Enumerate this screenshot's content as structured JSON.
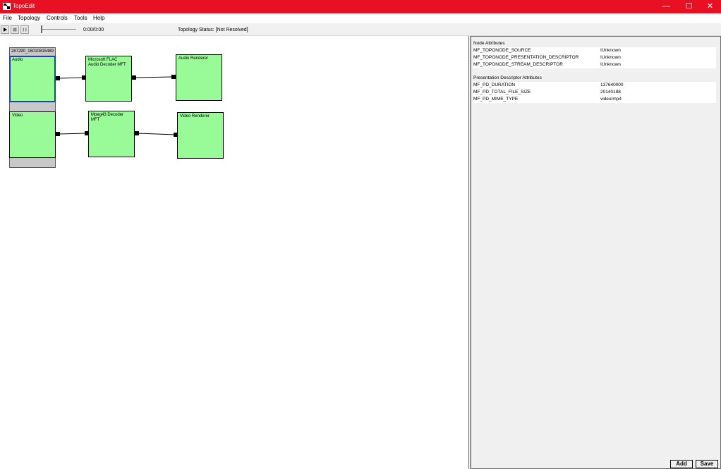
{
  "window": {
    "title": "TopoEdit",
    "minimize_glyph": "—",
    "maximize_glyph": "☐",
    "close_glyph": "✕"
  },
  "menu": [
    "File",
    "Topology",
    "Controls",
    "Tools",
    "Help"
  ],
  "toolbar": {
    "time": "0:00/0:00",
    "status": "Topology Status: [Not Resolved]"
  },
  "topology": {
    "source": {
      "name": "287290_16010815489",
      "streams": [
        "Audio",
        "Video"
      ]
    },
    "decoders": [
      "Microsoft FLAC Audio Decoder MFT",
      "Mpeg43 Decoder MFT"
    ],
    "renderers": [
      "Audio Renderer",
      "Video Renderer"
    ]
  },
  "attributes": {
    "node_title": "Node Attributes",
    "node": [
      {
        "name": "MF_TOPONODE_SOURCE",
        "value": "IUnknown"
      },
      {
        "name": "MF_TOPONODE_PRESENTATION_DESCRIPTOR",
        "value": "IUnknown"
      },
      {
        "name": "MF_TOPONODE_STREAM_DESCRIPTOR",
        "value": "IUnknown"
      }
    ],
    "pd_title": "Presentation Descriptor Attributes",
    "pd": [
      {
        "name": "MF_PD_DURATION",
        "value": "137640000"
      },
      {
        "name": "MF_PD_TOTAL_FILE_SIZE",
        "value": "20140188"
      },
      {
        "name": "MF_PD_MIME_TYPE",
        "value": "video/mp4"
      }
    ]
  },
  "buttons": {
    "add": "Add",
    "save": "Save"
  }
}
